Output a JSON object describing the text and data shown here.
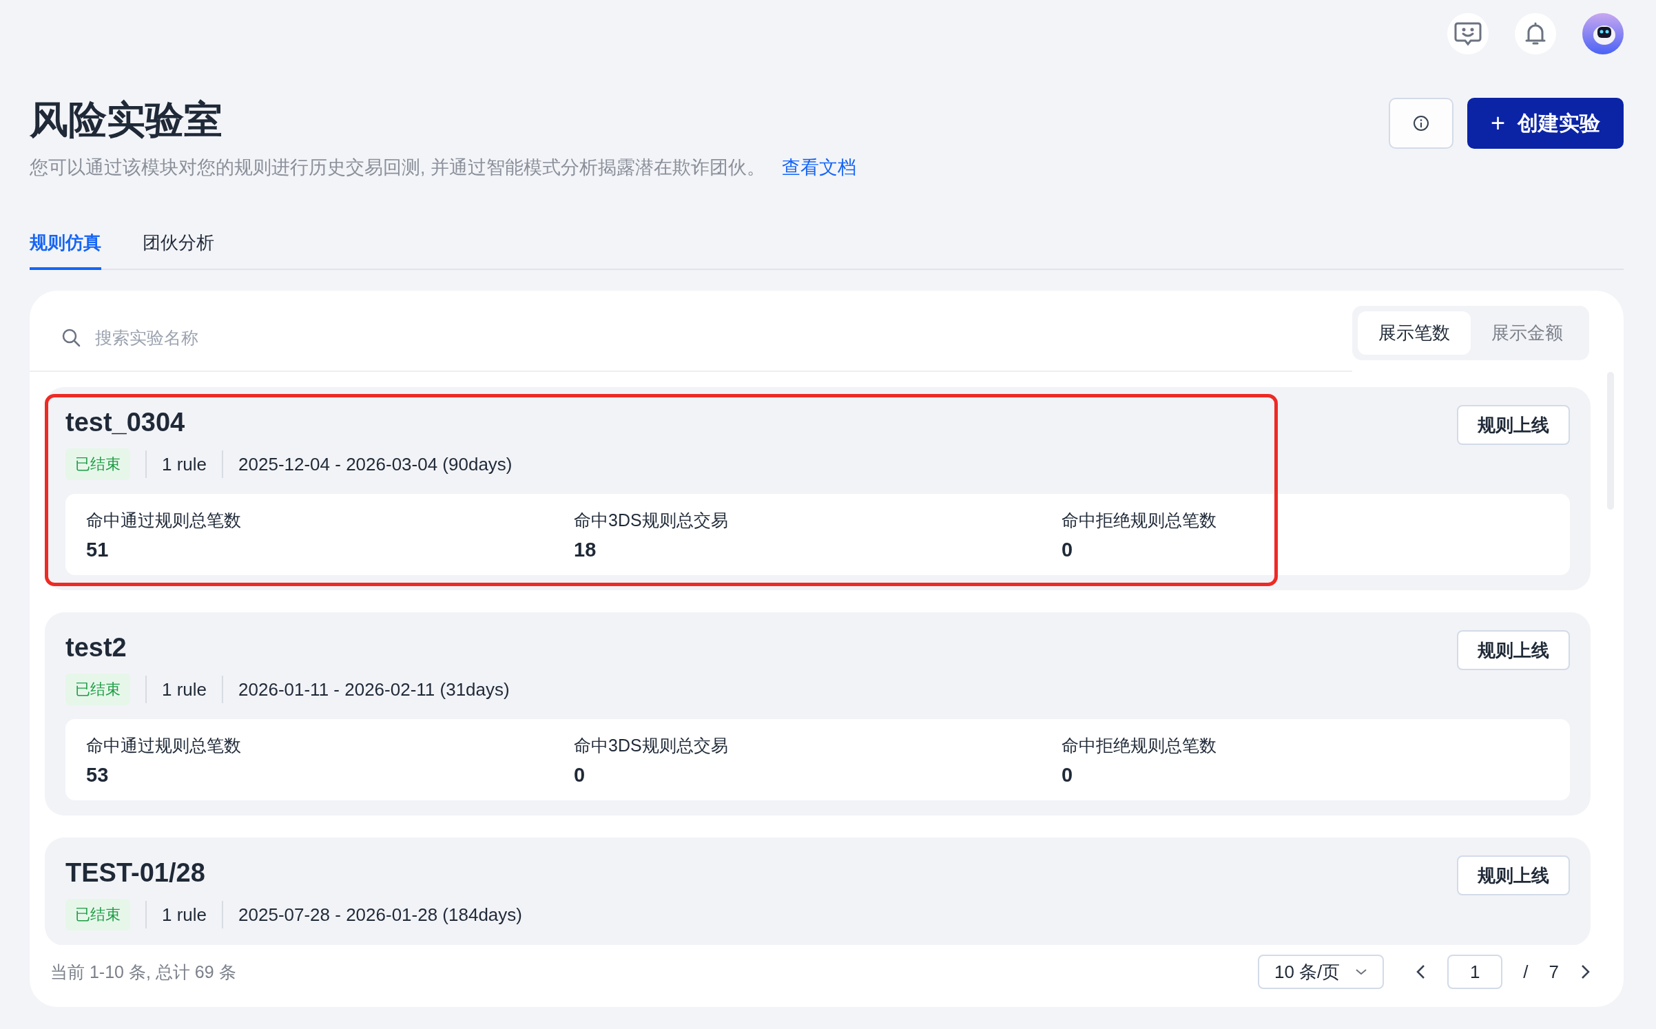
{
  "header": {
    "title": "风险实验室",
    "description": "您可以通过该模块对您的规则进行历史交易回测, 并通过智能模式分析揭露潜在欺诈团伙。",
    "doc_link": "查看文档",
    "create_button": "创建实验",
    "plus_glyph": "+"
  },
  "tabs": [
    {
      "label": "规则仿真",
      "selected": true
    },
    {
      "label": "团伙分析",
      "selected": false
    }
  ],
  "search": {
    "placeholder": "搜索实验名称"
  },
  "display_toggle": [
    {
      "label": "展示笔数",
      "selected": true
    },
    {
      "label": "展示金额",
      "selected": false
    }
  ],
  "experiments": [
    {
      "name": "test_0304",
      "status": "已结束",
      "rules": "1 rule",
      "period": "2025-12-04 - 2026-03-04 (90days)",
      "action": "规则上线",
      "highlighted": true,
      "stats": [
        {
          "label": "命中通过规则总笔数",
          "value": "51"
        },
        {
          "label": "命中3DS规则总交易",
          "value": "18"
        },
        {
          "label": "命中拒绝规则总笔数",
          "value": "0"
        }
      ]
    },
    {
      "name": "test2",
      "status": "已结束",
      "rules": "1 rule",
      "period": "2026-01-11 - 2026-02-11 (31days)",
      "action": "规则上线",
      "highlighted": false,
      "stats": [
        {
          "label": "命中通过规则总笔数",
          "value": "53"
        },
        {
          "label": "命中3DS规则总交易",
          "value": "0"
        },
        {
          "label": "命中拒绝规则总笔数",
          "value": "0"
        }
      ]
    },
    {
      "name": "TEST-01/28",
      "status": "已结束",
      "rules": "1 rule",
      "period": "2025-07-28 - 2026-01-28 (184days)",
      "action": "规则上线",
      "highlighted": false
    }
  ],
  "pagination": {
    "summary": "当前 1-10 条, 总计 69 条",
    "page_size": "10 条/页",
    "current_page": "1",
    "separator": "/",
    "total_pages": "7"
  }
}
